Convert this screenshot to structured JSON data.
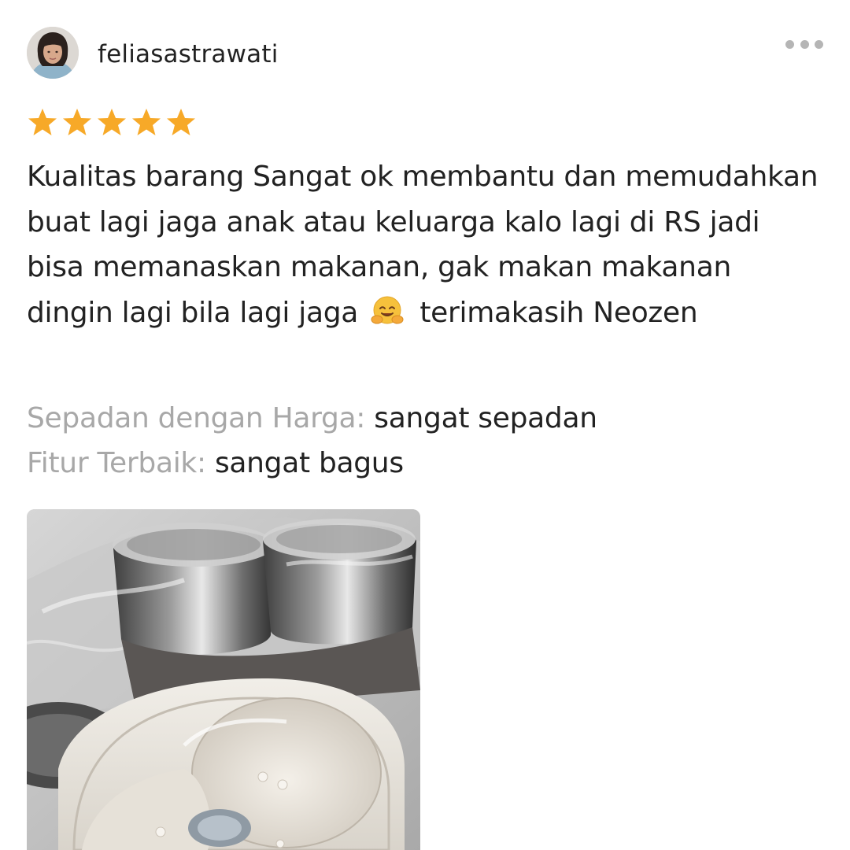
{
  "review": {
    "username": "feliasastrawati",
    "rating": 5,
    "rating_max": 5,
    "text_part1": "Kualitas barang Sangat ok membantu dan memudahkan buat lagi jaga anak atau keluarga kalo lagi di RS jadi bisa memanaskan makanan, gak makan makanan dingin lagi bila lagi jaga",
    "emoji": "hugging-face-emoji",
    "text_part2": "terimakasih Neozen",
    "attributes": [
      {
        "label": "Sepadan dengan Harga:",
        "value": "sangat sepadan"
      },
      {
        "label": "Fitur Terbaik:",
        "value": "sangat bagus"
      }
    ]
  },
  "colors": {
    "star": "#f7a928",
    "text": "#222222",
    "muted": "#a8a8a8",
    "more_dots": "#b5b5b5"
  }
}
